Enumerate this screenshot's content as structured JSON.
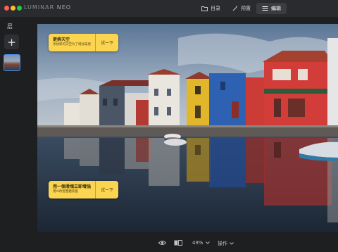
{
  "app": {
    "brand_main": "LUMINAR",
    "brand_neo": "NEO"
  },
  "top_tabs": [
    {
      "label": "目录",
      "icon": "folder-icon",
      "active": false
    },
    {
      "label": "预置",
      "icon": "magic-wand-icon",
      "active": false
    },
    {
      "label": "编辑",
      "icon": "sliders-icon",
      "active": true
    }
  ],
  "sidebar": {
    "title": "层",
    "add_label": "+"
  },
  "tips": [
    {
      "title": "更换天空",
      "subtitle": "添加新的天空为了增加美感",
      "button": "试一下"
    },
    {
      "title": "用一個滑塊立即增強",
      "subtitle": "用AI改善整體質量",
      "button": "试一下"
    }
  ],
  "bottom": {
    "zoom": "49%",
    "actions": "操作"
  }
}
